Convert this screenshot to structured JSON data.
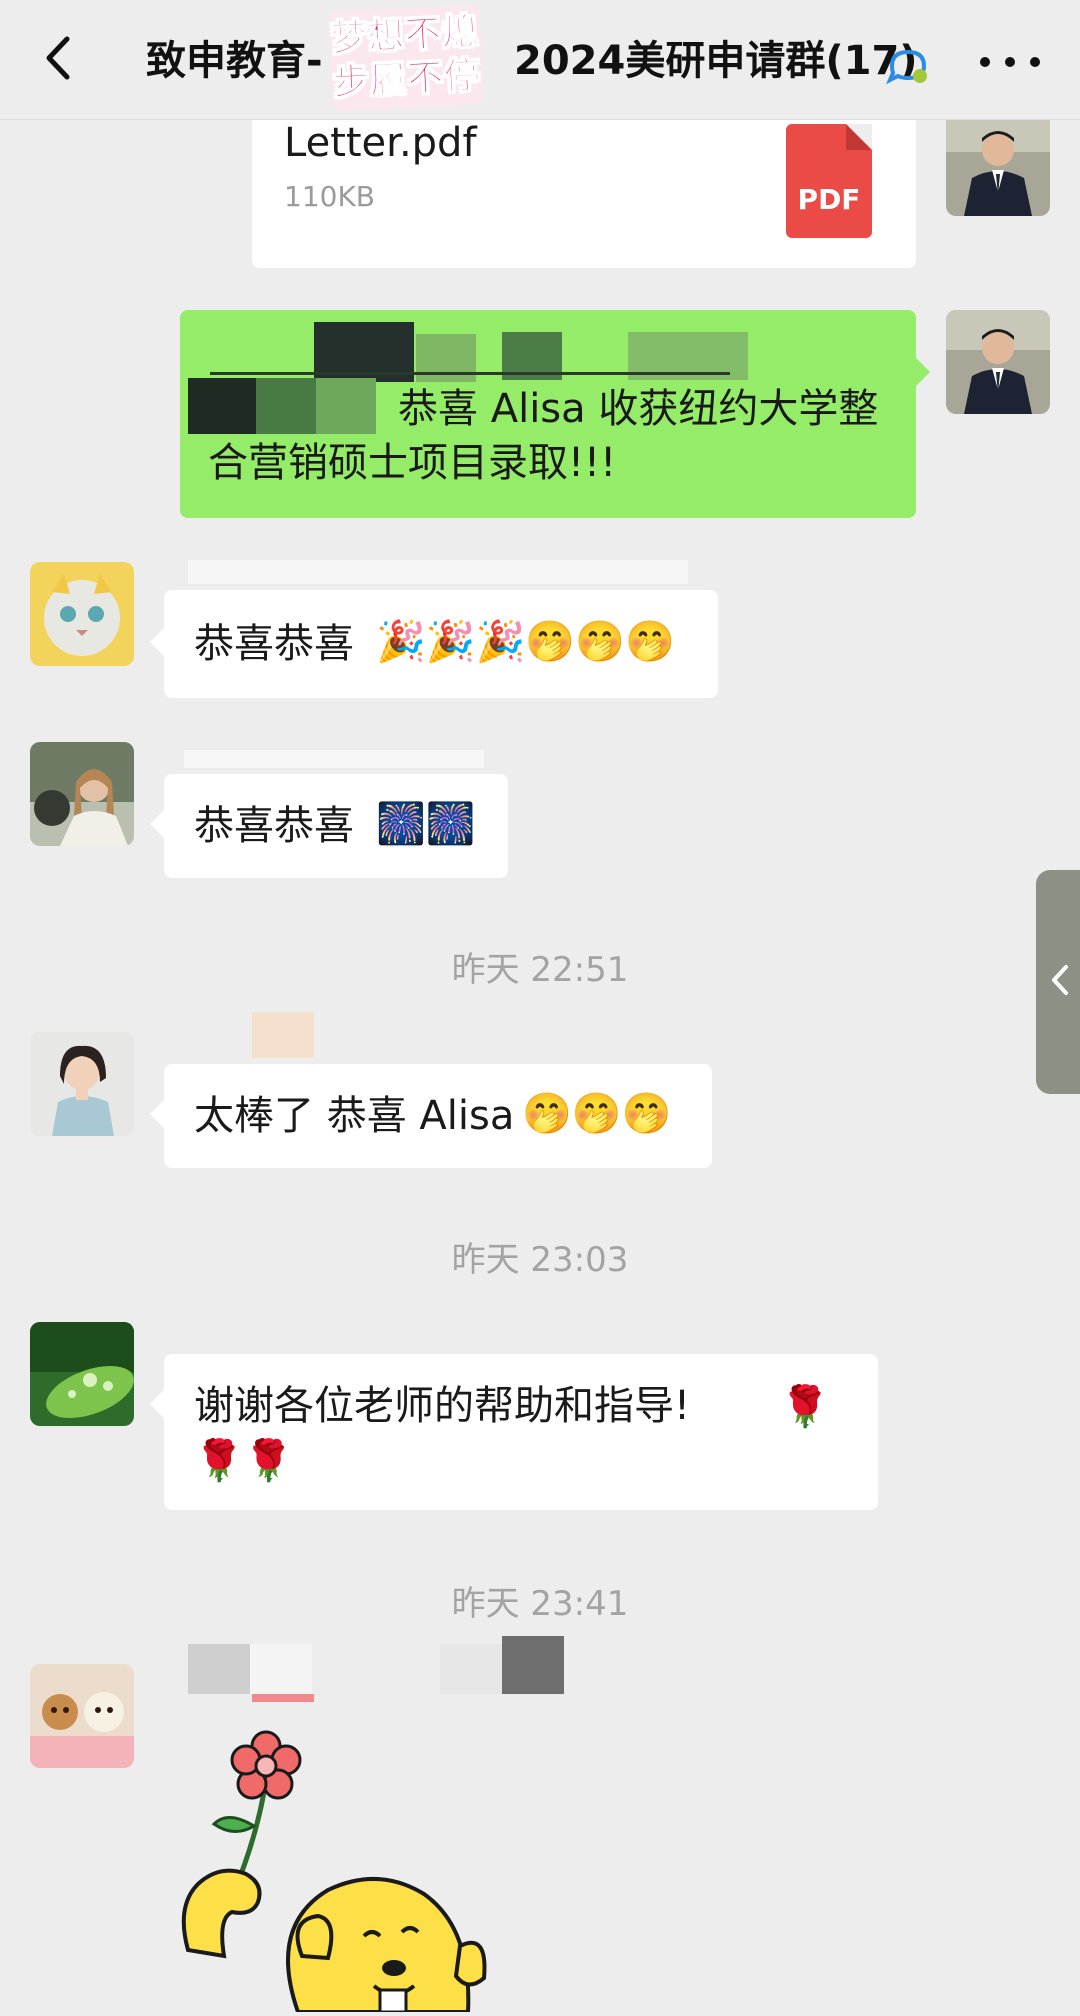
{
  "header": {
    "title_left": "致申教育-",
    "title_right": "2024美研申请群(17)",
    "sticker_line1": "梦想不熄",
    "sticker_line2": "步履不停"
  },
  "file_message": {
    "file_name": "Letter.pdf",
    "file_size": "110KB",
    "file_type": "PDF"
  },
  "messages": [
    {
      "id": "m1",
      "side": "right",
      "text": "恭喜 Alisa 收获纽约大学整合营销硕士项目录取!!!"
    },
    {
      "id": "m2",
      "side": "left",
      "text": "恭喜恭喜",
      "emoji": "🎉🎉🎉🤭🤭🤭"
    },
    {
      "id": "m3",
      "side": "left",
      "text": "恭喜恭喜",
      "emoji": "🎆🎆"
    },
    {
      "id": "m4",
      "side": "left",
      "text": "太棒了 恭喜 Alisa",
      "emoji": "🤭🤭🤭"
    },
    {
      "id": "m5",
      "side": "left",
      "text": "谢谢各位老师的帮助和指导!",
      "emoji": "🌹🌹🌹"
    }
  ],
  "timestamps": [
    "昨天 22:51",
    "昨天 23:03",
    "昨天 23:41"
  ],
  "colors": {
    "background": "#ededed",
    "bubble_green": "#95ec69",
    "bubble_white": "#ffffff",
    "pdf_red": "#ea4b47",
    "sticker_pink": "#ea1f5a"
  },
  "icons": [
    "back-arrow-icon",
    "group-chat-icon",
    "more-icon",
    "pdf-icon",
    "side-collapse-icon"
  ]
}
